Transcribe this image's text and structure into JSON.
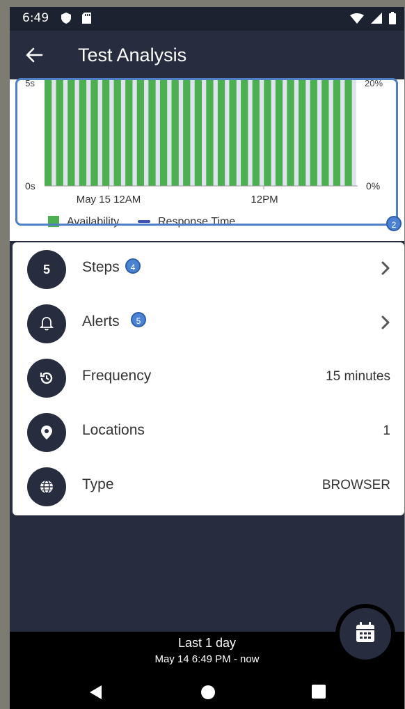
{
  "status_bar": {
    "time": "6:49",
    "icons": [
      "shield-icon",
      "sd-card-icon",
      "wifi-icon",
      "cellular-icon",
      "battery-icon"
    ]
  },
  "app_bar": {
    "back_icon": "arrow-left-icon",
    "title": "Test Analysis"
  },
  "chart": {
    "annotation_badge": "2",
    "y_left_top": "5s",
    "y_left_bottom": "0s",
    "y_right_top": "20%",
    "y_right_bottom": "0%",
    "x_tick_1": "May 15 12AM",
    "x_tick_2": "12PM",
    "legend_availability": "Availability",
    "legend_response": "Response Time",
    "colors": {
      "availability": "#4caf50",
      "response": "#3f51b5",
      "gap": "#dfe3ee"
    }
  },
  "chart_data": {
    "type": "bar",
    "series": [
      {
        "name": "Availability",
        "values": [
          100,
          100,
          100,
          100,
          100,
          100,
          100,
          100,
          100,
          100,
          100,
          100,
          100,
          100,
          100,
          100,
          100,
          100,
          100,
          100,
          100,
          100,
          100,
          100,
          100,
          100,
          100
        ]
      },
      {
        "name": "Response Time",
        "values": []
      }
    ],
    "x_ticks": [
      "May 15 12AM",
      "12PM"
    ],
    "y_left_ticks": [
      "0s",
      "5s"
    ],
    "y_right_ticks": [
      "0%",
      "20%"
    ],
    "legend": "bottom-left",
    "grid": false
  },
  "list": {
    "steps": {
      "count": "5",
      "label": "Steps",
      "badge": "4"
    },
    "alerts": {
      "icon": "bell-icon",
      "label": "Alerts",
      "badge": "5"
    },
    "frequency": {
      "icon": "history-icon",
      "label": "Frequency",
      "value": "15 minutes"
    },
    "locations": {
      "icon": "location-pin-icon",
      "label": "Locations",
      "value": "1"
    },
    "type": {
      "icon": "globe-icon",
      "label": "Type",
      "value": "BROWSER"
    }
  },
  "bottom": {
    "range_label": "Last 1 day",
    "range_detail": "May 14 6:49 PM - now",
    "fab_icon": "calendar-icon"
  },
  "nav_bar": {
    "buttons": [
      "back-triangle-icon",
      "home-circle-icon",
      "recents-square-icon"
    ]
  }
}
